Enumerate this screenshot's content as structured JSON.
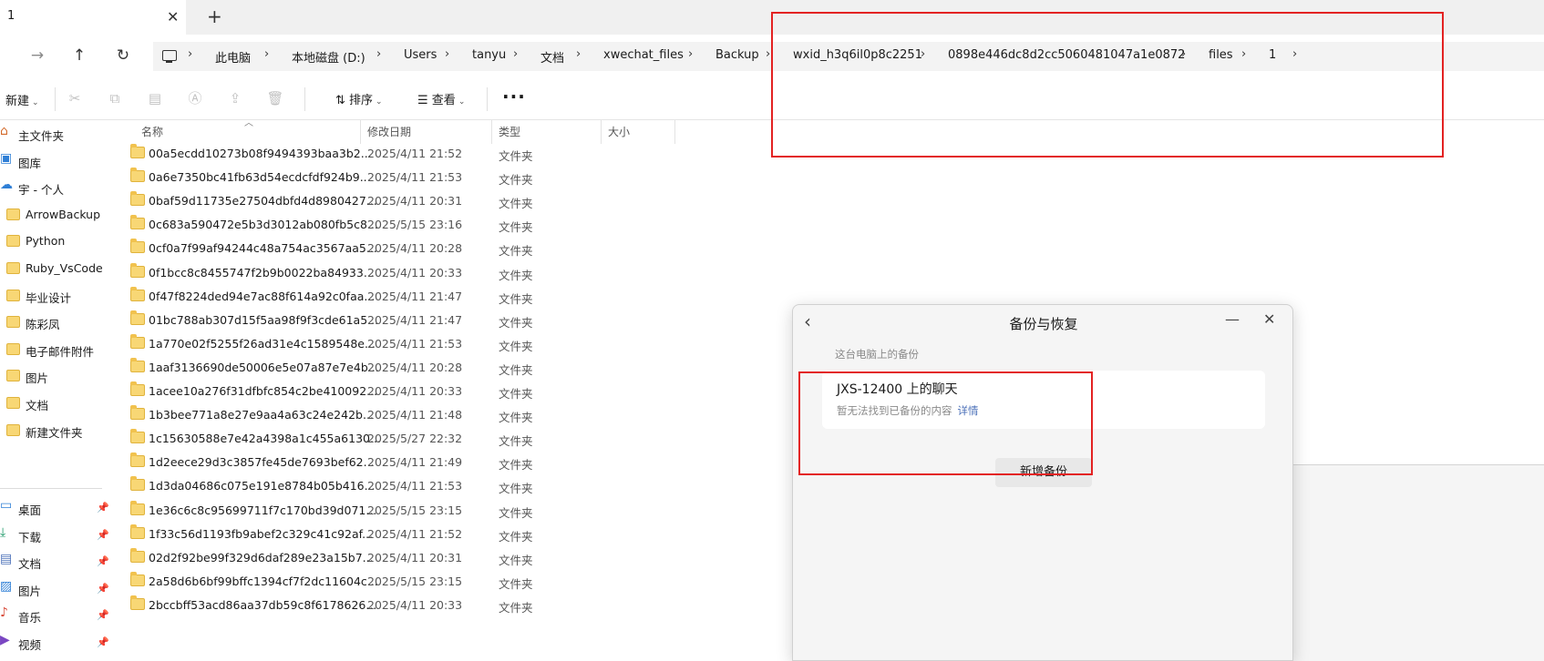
{
  "tab": {
    "title": "1",
    "close": "✕",
    "new": "+"
  },
  "nav": {
    "forward": "→",
    "up": "↑",
    "refresh": "↻"
  },
  "breadcrumb": [
    "此电脑",
    "本地磁盘 (D:)",
    "Users",
    "tanyu",
    "文档",
    "xwechat_files",
    "Backup",
    "wxid_h3q6il0p8c2251",
    "0898e446dc8d2cc5060481047a1e0872",
    "files",
    "1"
  ],
  "toolbar": {
    "new_label": "新建",
    "sort_label": "排序",
    "view_label": "查看",
    "more_label": "···",
    "icons": [
      "cut-icon",
      "copy-icon",
      "paste-icon",
      "rename-icon",
      "share-icon",
      "delete-icon"
    ]
  },
  "sidebar": {
    "items": [
      {
        "label": "主文件夹",
        "icon": "home-icon"
      },
      {
        "label": "图库",
        "icon": "gallery-icon"
      },
      {
        "label": "宇 - 个人",
        "icon": "onedrive-icon"
      },
      {
        "label": "ArrowBackup",
        "icon": "folder-icon"
      },
      {
        "label": "Python",
        "icon": "folder-icon"
      },
      {
        "label": "Ruby_VsCode",
        "icon": "folder-icon"
      },
      {
        "label": "毕业设计",
        "icon": "folder-icon"
      },
      {
        "label": "陈彩凤",
        "icon": "folder-icon"
      },
      {
        "label": "电子邮件附件",
        "icon": "folder-icon"
      },
      {
        "label": "图片",
        "icon": "folder-icon"
      },
      {
        "label": "文档",
        "icon": "folder-icon"
      },
      {
        "label": "新建文件夹",
        "icon": "folder-icon"
      }
    ],
    "pinned": [
      {
        "label": "桌面",
        "icon": "desktop-icon"
      },
      {
        "label": "下载",
        "icon": "download-icon"
      },
      {
        "label": "文档",
        "icon": "document-icon"
      },
      {
        "label": "图片",
        "icon": "picture-icon"
      },
      {
        "label": "音乐",
        "icon": "music-icon"
      },
      {
        "label": "视频",
        "icon": "video-icon"
      }
    ]
  },
  "columns": {
    "name": "名称",
    "date": "修改日期",
    "type": "类型",
    "size": "大小"
  },
  "files": [
    {
      "name": "00a5ecdd10273b08f9494393baa3b2...",
      "date": "2025/4/11 21:52",
      "type": "文件夹"
    },
    {
      "name": "0a6e7350bc41fb63d54ecdcfdf924b9...",
      "date": "2025/4/11 21:53",
      "type": "文件夹"
    },
    {
      "name": "0baf59d11735e27504dbfd4d8980427...",
      "date": "2025/4/11 20:31",
      "type": "文件夹"
    },
    {
      "name": "0c683a590472e5b3d3012ab080fb5c8...",
      "date": "2025/5/15 23:16",
      "type": "文件夹"
    },
    {
      "name": "0cf0a7f99af94244c48a754ac3567aa5...",
      "date": "2025/4/11 20:28",
      "type": "文件夹"
    },
    {
      "name": "0f1bcc8c8455747f2b9b0022ba84933...",
      "date": "2025/4/11 20:33",
      "type": "文件夹"
    },
    {
      "name": "0f47f8224ded94e7ac88f614a92c0faa...",
      "date": "2025/4/11 21:47",
      "type": "文件夹"
    },
    {
      "name": "01bc788ab307d15f5aa98f9f3cde61a5...",
      "date": "2025/4/11 21:47",
      "type": "文件夹"
    },
    {
      "name": "1a770e02f5255f26ad31e4c1589548e...",
      "date": "2025/4/11 21:53",
      "type": "文件夹"
    },
    {
      "name": "1aaf3136690de50006e5e07a87e7e4b...",
      "date": "2025/4/11 20:28",
      "type": "文件夹"
    },
    {
      "name": "1acee10a276f31dfbfc854c2be410092...",
      "date": "2025/4/11 20:33",
      "type": "文件夹"
    },
    {
      "name": "1b3bee771a8e27e9aa4a63c24e242b...",
      "date": "2025/4/11 21:48",
      "type": "文件夹"
    },
    {
      "name": "1c15630588e7e42a4398a1c455a6130...",
      "date": "2025/5/27 22:32",
      "type": "文件夹"
    },
    {
      "name": "1d2eece29d3c3857fe45de7693bef62...",
      "date": "2025/4/11 21:49",
      "type": "文件夹"
    },
    {
      "name": "1d3da04686c075e191e8784b05b416...",
      "date": "2025/4/11 21:53",
      "type": "文件夹"
    },
    {
      "name": "1e36c6c8c95699711f7c170bd39d071...",
      "date": "2025/5/15 23:15",
      "type": "文件夹"
    },
    {
      "name": "1f33c56d1193fb9abef2c329c41c92af...",
      "date": "2025/4/11 21:52",
      "type": "文件夹"
    },
    {
      "name": "02d2f92be99f329d6daf289e23a15b7...",
      "date": "2025/4/11 20:31",
      "type": "文件夹"
    },
    {
      "name": "2a58d6b6bf99bffc1394cf7f2dc11604c...",
      "date": "2025/5/15 23:15",
      "type": "文件夹"
    },
    {
      "name": "2bccbff53acd86aa37db59c8f6178626...",
      "date": "2025/4/11 20:33",
      "type": "文件夹"
    }
  ],
  "dialog": {
    "title": "备份与恢复",
    "back": "‹",
    "minimize": "—",
    "close": "✕",
    "section_label": "这台电脑上的备份",
    "card_title": "JXS-12400 上的聊天",
    "card_status": "暂无法找到已备份的内容",
    "card_link": "详情",
    "new_backup_button": "新增备份"
  },
  "colors": {
    "annotation": "#e32222",
    "folder": "#f8d775",
    "link": "#4a6fb8"
  }
}
